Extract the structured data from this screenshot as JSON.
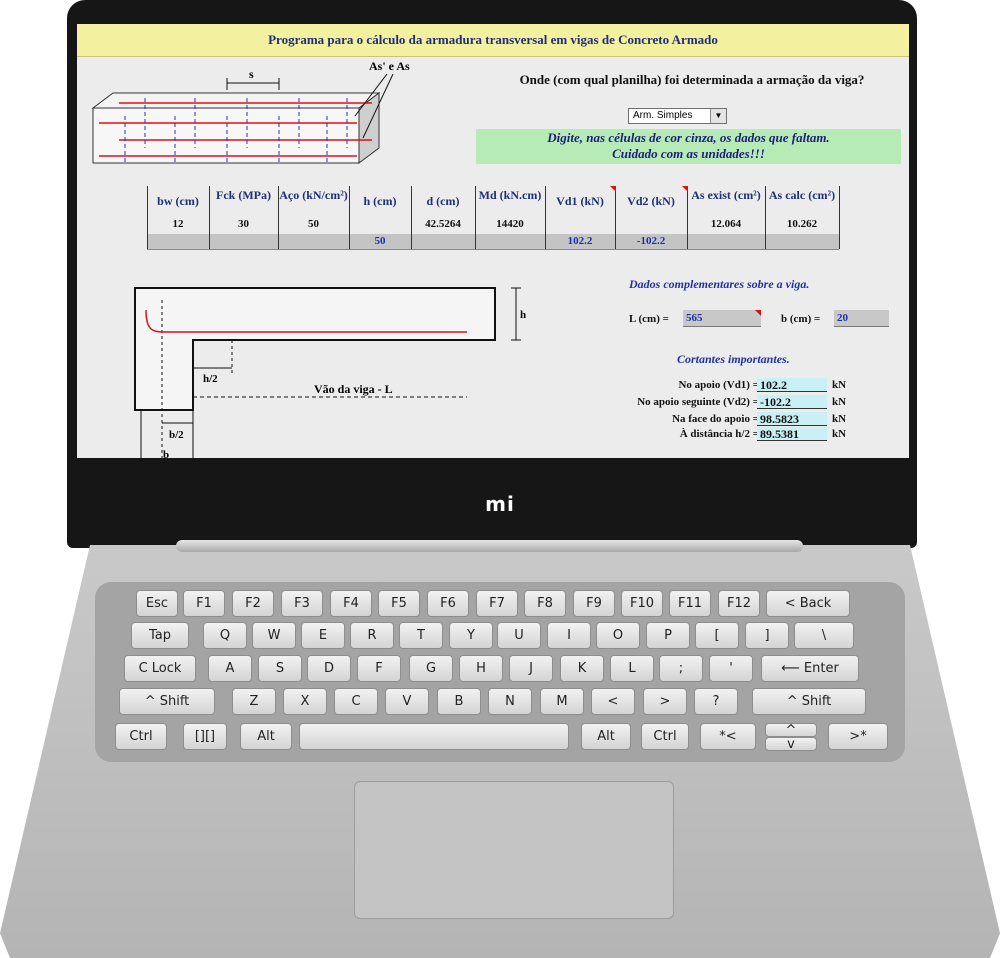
{
  "device": {
    "brand": "mi"
  },
  "app": {
    "title": "Programa para o cálculo da armadura transversal em vigas de Concreto Armado",
    "question": "Onde (com qual planilha) foi determinada a armação da viga?",
    "dropdown": {
      "selected": "Arm. Simples"
    },
    "notice_line1": "Digite, nas células de cor cinza, os dados que faltam.",
    "notice_line2": "Cuidado com as unidades!!!",
    "diagram_top": {
      "label_as": "As' e As",
      "label_s": "s"
    },
    "table": {
      "headers": [
        "bw (cm)",
        "Fck (MPa)",
        "Aço (kN/cm²)",
        "h (cm)",
        "d (cm)",
        "Md (kN.cm)",
        "Vd1 (kN)",
        "Vd2 (kN)",
        "As exist (cm²)",
        "As calc (cm²)"
      ],
      "values": [
        "12",
        "30",
        "50",
        "",
        "42.5264",
        "14420",
        "",
        "",
        "12.064",
        "10.262"
      ],
      "inputs": [
        "",
        "",
        "",
        "50",
        "",
        "",
        "102.2",
        "-102.2",
        "",
        ""
      ]
    },
    "beam_diagram": {
      "label_h": "h",
      "label_h2": "h/2",
      "label_b2": "b/2",
      "label_span": "Vão da viga - L",
      "label_b": "b"
    },
    "complementary": {
      "title": "Dados complementares sobre a viga.",
      "L_label": "L (cm) =",
      "L_value": "565",
      "b_label": "b (cm) =",
      "b_value": "20"
    },
    "shear": {
      "title": "Cortantes importantes.",
      "rows": [
        {
          "label": "No apoio (Vd1) =",
          "value": "102.2",
          "unit": "kN"
        },
        {
          "label": "No apoio seguinte (Vd2) =",
          "value": "-102.2",
          "unit": "kN"
        },
        {
          "label": "Na face do apoio =",
          "value": "98.5823",
          "unit": "kN"
        },
        {
          "label": "À distância h/2 =",
          "value": "89.5381",
          "unit": "kN"
        }
      ]
    }
  },
  "keyboard": {
    "rows": [
      [
        "Esc",
        "F1",
        "F2",
        "F3",
        "F4",
        "F5",
        "F6",
        "F7",
        "F8",
        "F9",
        "F10",
        "F11",
        "F12",
        "< Back"
      ],
      [
        "Tap",
        "Q",
        "W",
        "E",
        "R",
        "T",
        "Y",
        "U",
        "I",
        "O",
        "P",
        "[",
        "]",
        "\\"
      ],
      [
        "C Lock",
        "A",
        "S",
        "D",
        "F",
        "G",
        "H",
        "J",
        "K",
        "L",
        ";",
        "'",
        "⟵ Enter"
      ],
      [
        "^ Shift",
        "Z",
        "X",
        "C",
        "V",
        "B",
        "N",
        "M",
        "<",
        ">",
        "?",
        "^ Shift"
      ],
      [
        "Ctrl",
        "[][]",
        "Alt",
        "",
        "Alt",
        "Ctrl",
        "*<",
        "^",
        "v",
        ">*"
      ]
    ]
  }
}
